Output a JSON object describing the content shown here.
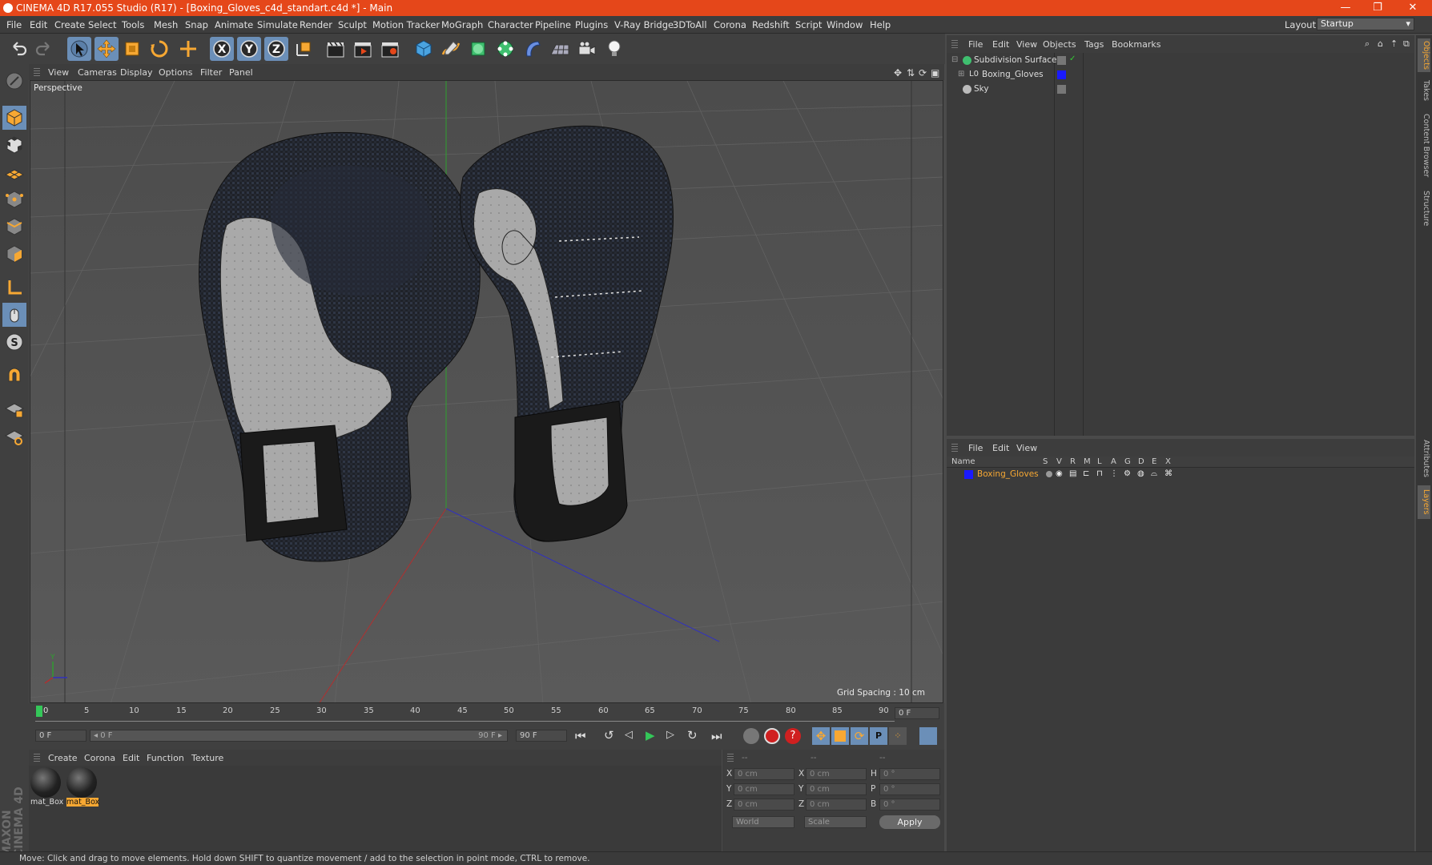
{
  "window": {
    "title": "CINEMA 4D R17.055 Studio (R17) - [Boxing_Gloves_c4d_standart.c4d *] - Main",
    "minimize": "—",
    "maximize": "❐",
    "close": "✕"
  },
  "menubar": {
    "items": [
      "File",
      "Edit",
      "Create",
      "Select",
      "Tools",
      "Mesh",
      "Snap",
      "Animate",
      "Simulate",
      "Render",
      "Sculpt",
      "Motion Tracker",
      "MoGraph",
      "Character",
      "Pipeline",
      "Plugins",
      "V-Ray Bridge",
      "3DToAll",
      "Corona",
      "Redshift",
      "Script",
      "Window",
      "Help"
    ],
    "layout_label": "Layout:",
    "layout_value": "Startup"
  },
  "viewport": {
    "menu": [
      "View",
      "Cameras",
      "Display",
      "Options",
      "Filter",
      "Panel"
    ],
    "camera_label": "Perspective",
    "grid_spacing": "Grid Spacing : 10 cm"
  },
  "timeline": {
    "ticks": [
      "0",
      "5",
      "10",
      "15",
      "20",
      "25",
      "30",
      "35",
      "40",
      "45",
      "50",
      "55",
      "60",
      "65",
      "70",
      "75",
      "80",
      "85",
      "90"
    ],
    "current_frame": "0 F"
  },
  "transport": {
    "start": "0 F",
    "range_left": "◂ 0 F",
    "range_right": "90 F ▸",
    "end": "90 F"
  },
  "materials": {
    "menu": [
      "Create",
      "Corona",
      "Edit",
      "Function",
      "Texture"
    ],
    "items": [
      {
        "name": "mat_Box",
        "selected": false
      },
      {
        "name": "mat_Box",
        "selected": true
      }
    ]
  },
  "coordinates": {
    "headers": [
      "--",
      "--",
      "--"
    ],
    "rows": [
      {
        "a": "X",
        "av": "0 cm",
        "b": "X",
        "bv": "0 cm",
        "c": "H",
        "cv": "0 °"
      },
      {
        "a": "Y",
        "av": "0 cm",
        "b": "Y",
        "bv": "0 cm",
        "c": "P",
        "cv": "0 °"
      },
      {
        "a": "Z",
        "av": "0 cm",
        "b": "Z",
        "bv": "0 cm",
        "c": "B",
        "cv": "0 °"
      }
    ],
    "mode": "World",
    "scale": "Scale",
    "apply": "Apply"
  },
  "object_manager": {
    "menu": [
      "File",
      "Edit",
      "View",
      "Objects",
      "Tags",
      "Bookmarks"
    ],
    "objects": [
      {
        "name": "Subdivision Surface",
        "icon": "subdivision-icon"
      },
      {
        "name": "Boxing_Gloves",
        "icon": "null-object-icon"
      },
      {
        "name": "Sky",
        "icon": "sky-icon"
      }
    ]
  },
  "layer_manager": {
    "menu": [
      "File",
      "Edit",
      "View"
    ],
    "columns": [
      "Name",
      "S",
      "V",
      "R",
      "M",
      "L",
      "A",
      "G",
      "D",
      "E",
      "X"
    ],
    "layers": [
      {
        "name": "Boxing_Gloves"
      }
    ]
  },
  "right_tabs": [
    "Objects",
    "Takes",
    "Content Browser",
    "Structure",
    "Attributes",
    "Layers"
  ],
  "status": "Move: Click and drag to move elements. Hold down SHIFT to quantize movement / add to the selection in point mode, CTRL to remove.",
  "brand": "MAXON CINEMA 4D",
  "colors": {
    "title_bar": "#e5471a",
    "accent_orange": "#f7a833",
    "layer_blue": "#1a1aff"
  }
}
